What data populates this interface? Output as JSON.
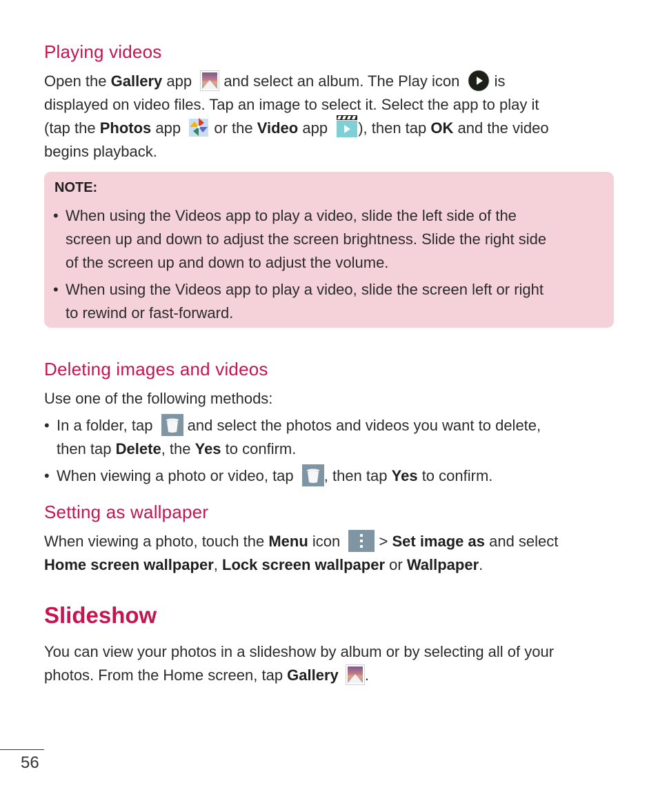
{
  "playing_videos": {
    "heading": "Playing videos",
    "p1": "Open the ",
    "gallery": "Gallery",
    "p2": " app",
    "p3": " and select an album. The Play icon",
    "p4": " is",
    "line2": "displayed on video files. Tap an image to select it. Select the app to play it",
    "l3a": "(tap the ",
    "photos": "Photos",
    "l3b": " app",
    "l3c": " or the ",
    "video": "Video",
    "l3d": " app",
    "l3e": "), then tap ",
    "ok": "OK",
    "l3f": " and the video",
    "line4": "begins playback."
  },
  "note": {
    "label": "NOTE:",
    "items": [
      {
        "lines": [
          "When using the Videos app to play a video, slide the left side of the",
          "screen up and down to adjust the screen brightness. Slide the right side",
          "of the screen up and down to adjust the volume."
        ]
      },
      {
        "lines": [
          "When using the Videos app to play a video, slide the screen left or right",
          "to rewind or fast-forward."
        ]
      }
    ]
  },
  "deleting": {
    "heading": "Deleting images and videos",
    "intro": "Use one of the following methods:",
    "b1a": "In a folder, tap",
    "b1b": " and select the photos and videos you want to delete,",
    "b1c": "then tap ",
    "delete": "Delete",
    "b1d": ", the ",
    "yes": "Yes",
    "b1e": " to confirm.",
    "b2a": "When viewing a photo or video, tap",
    "b2b": ", then tap ",
    "b2c": " to confirm."
  },
  "wallpaper": {
    "heading": "Setting as wallpaper",
    "a": "When viewing a photo, touch the ",
    "menu": "Menu",
    "b": " icon",
    "c": " > ",
    "set_image": "Set image as",
    "d": " and select",
    "home": "Home screen wallpaper",
    "sep": ", ",
    "lock": "Lock screen wallpaper",
    "or": " or ",
    "wp": "Wallpaper",
    "end": "."
  },
  "slideshow": {
    "heading": "Slideshow",
    "line1": "You can view your photos in a slideshow by album or by selecting all of your",
    "l2a": "photos. From the Home screen, tap ",
    "gallery": "Gallery",
    "l2b": "."
  },
  "icons": {
    "gallery": "gallery-app-icon",
    "play": "play-icon",
    "photos": "photos-app-icon",
    "video": "video-app-icon",
    "trash": "trash-icon",
    "menu": "menu-icon"
  },
  "footer": {
    "page_number": "56"
  },
  "colors": {
    "accent": "#c4154f",
    "note_bg": "#f5d2d9",
    "icon_bg": "#7f95a3"
  }
}
